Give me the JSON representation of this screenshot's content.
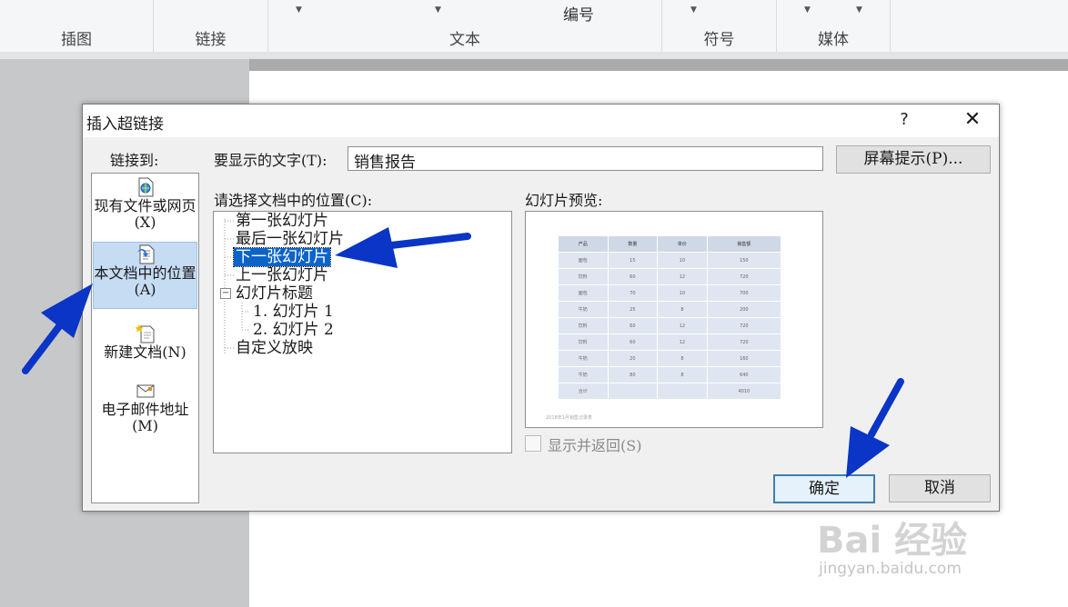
{
  "ribbon": {
    "groups": [
      "插图",
      "链接",
      "文本",
      "符号",
      "媒体"
    ],
    "numbering_label": "编号"
  },
  "dialog": {
    "title": "插入超链接",
    "help": "?",
    "close": "✕",
    "link_to_label": "链接到:",
    "link_options": [
      {
        "label": "现有文件或网页(X)",
        "icon": "web-file-icon"
      },
      {
        "label": "本文档中的位置(A)",
        "icon": "document-place-icon",
        "active": true
      },
      {
        "label": "新建文档(N)",
        "icon": "new-document-icon"
      },
      {
        "label": "电子邮件地址(M)",
        "icon": "email-icon"
      }
    ],
    "display_text_label": "要显示的文字(T):",
    "display_text_value": "销售报告",
    "screentip_button": "屏幕提示(P)...",
    "place_label": "请选择文档中的位置(C):",
    "tree": [
      "第一张幻灯片",
      "最后一张幻灯片",
      "下一张幻灯片",
      "上一张幻灯片",
      "幻灯片标题",
      "1. 幻灯片 1",
      "2. 幻灯片 2",
      "自定义放映"
    ],
    "selected_tree_item": "下一张幻灯片",
    "preview_label": "幻灯片预览:",
    "show_and_return": "显示并返回(S)",
    "ok_button": "确定",
    "cancel_button": "取消"
  },
  "preview_table": {
    "headers": [
      "产品",
      "数量",
      "单价",
      "销售额"
    ],
    "rows": [
      [
        "面包",
        "15",
        "10",
        "150"
      ],
      [
        "饮料",
        "60",
        "12",
        "720"
      ],
      [
        "面包",
        "70",
        "10",
        "700"
      ],
      [
        "牛奶",
        "25",
        "8",
        "200"
      ],
      [
        "饮料",
        "60",
        "12",
        "720"
      ],
      [
        "饮料",
        "60",
        "12",
        "720"
      ],
      [
        "牛奶",
        "20",
        "8",
        "160"
      ],
      [
        "牛奶",
        "80",
        "8",
        "640"
      ],
      [
        "合计",
        "",
        "",
        "4010"
      ]
    ],
    "note": "2018年1月销售记录表"
  },
  "watermark": {
    "brand": "Bai 经验",
    "url": "jingyan.baidu.com"
  },
  "colors": {
    "selection": "#0b64c8",
    "annotation_arrow": "#0a35c6",
    "active_link": "#c5dcf3"
  }
}
